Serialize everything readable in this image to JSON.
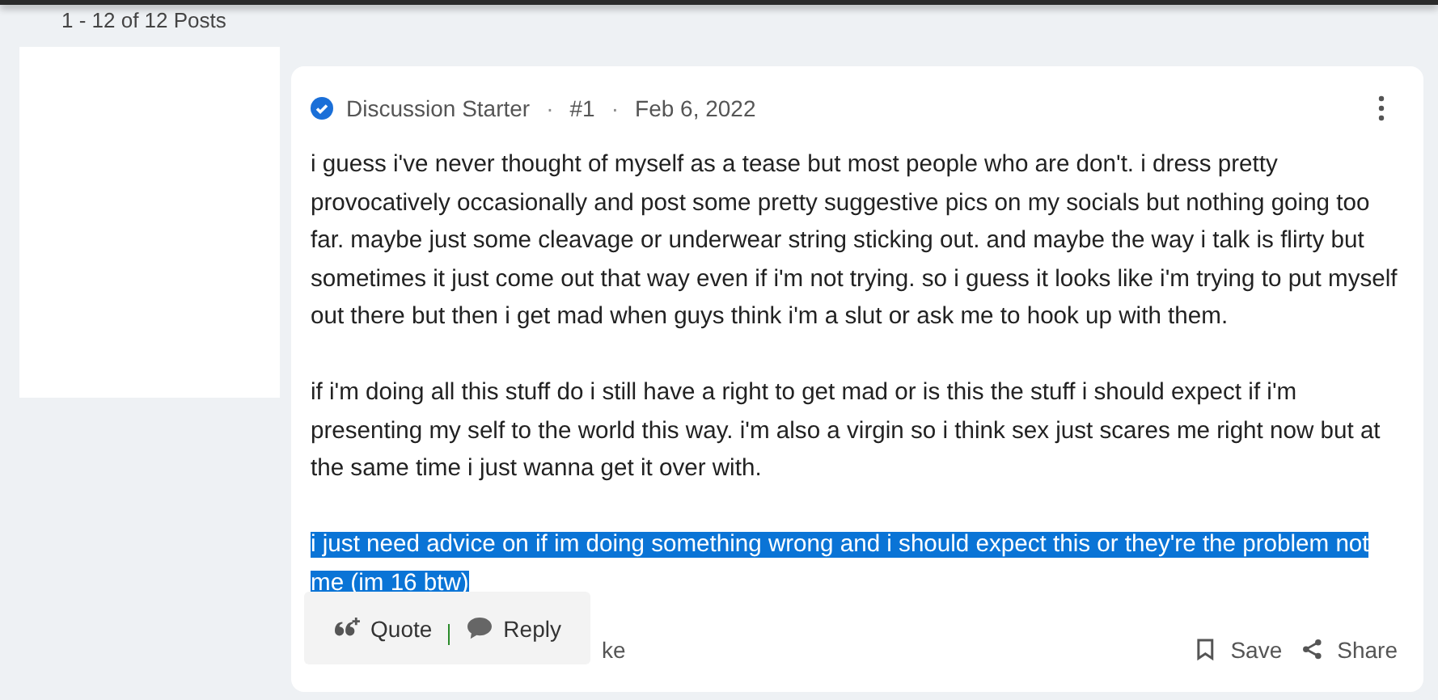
{
  "pagination": "1 - 12 of 12 Posts",
  "post": {
    "badge": "Discussion Starter",
    "separators": [
      "·",
      "·"
    ],
    "number": "#1",
    "date": "Feb 6, 2022",
    "paragraphs": [
      {
        "text": "i guess i've never thought of myself as a tease but most people who are don't. i dress pretty provocatively occasionally and post some pretty suggestive pics on my socials but nothing going too far. maybe just some cleavage or underwear string sticking out. and maybe the way i talk is flirty but sometimes it just come out that way even if i'm not trying. so i guess it looks like i'm trying to put myself out there but then i get mad when guys think i'm a slut or ask me to hook up with them.",
        "selected": false
      },
      {
        "text": "if i'm doing all this stuff do i still have a right to get mad or is this the stuff i should expect if i'm presenting my self to the world this way. i'm also a virgin so i think sex just scares me right now but at the same time i just wanna get it over with.",
        "selected": false
      },
      {
        "text": "i just need advice on if im doing something wrong and i should expect this or they're the problem not me (im 16 btw)",
        "selected": true
      }
    ],
    "like_partial": "ke",
    "actions": [
      {
        "label": "Save",
        "kind": "save"
      },
      {
        "label": "Share",
        "kind": "share"
      }
    ]
  },
  "selection_popup": [
    {
      "label": "Quote",
      "kind": "quote"
    },
    {
      "label": "Reply",
      "kind": "reply"
    }
  ]
}
